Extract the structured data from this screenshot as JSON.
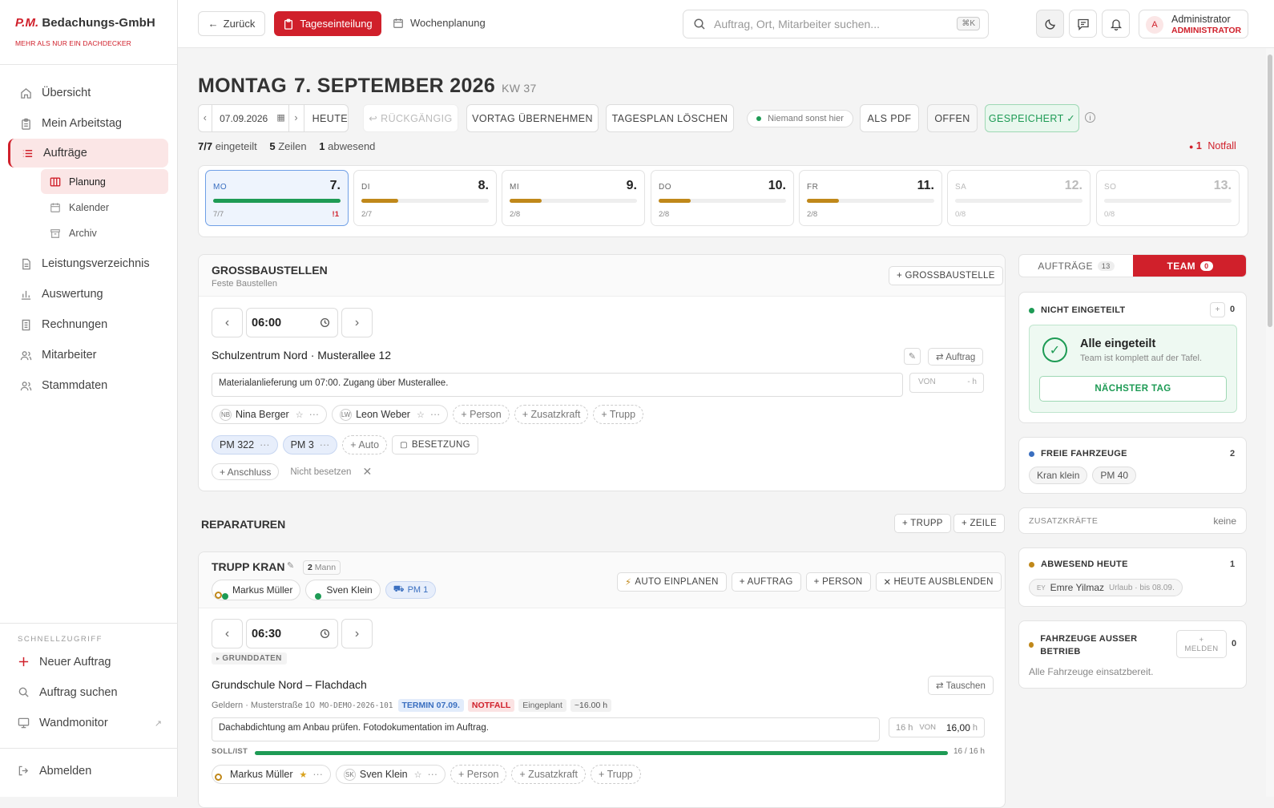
{
  "brand": {
    "pm": "P.M.",
    "name": "Bedachungs-GmbH",
    "tagline": "MEHR ALS NUR EIN DACHDECKER"
  },
  "nav": {
    "uebersicht": "Übersicht",
    "arbeitstag": "Mein Arbeitstag",
    "auftraege": "Aufträge",
    "planung": "Planung",
    "kalender": "Kalender",
    "archiv": "Archiv",
    "leistung": "Leistungsverzeichnis",
    "auswertung": "Auswertung",
    "rechnungen": "Rechnungen",
    "mitarbeiter": "Mitarbeiter",
    "stammdaten": "Stammdaten"
  },
  "quick": {
    "title": "SCHNELLZUGRIFF",
    "neu": "Neuer Auftrag",
    "suchen": "Auftrag suchen",
    "wand": "Wandmonitor",
    "abmelden": "Abmelden"
  },
  "topbar": {
    "back": "Zurück",
    "tages": "Tageseinteilung",
    "wochen": "Wochenplanung",
    "search_ph": "Auftrag, Ort, Mitarbeiter suchen...",
    "kbd": "⌘K",
    "user_name": "Administrator",
    "user_role": "ADMINISTRATOR",
    "avatar": "A"
  },
  "header": {
    "weekday": "MONTAG",
    "date": "7. SEPTEMBER 2026",
    "kw": "KW 37"
  },
  "toolbar": {
    "date": "07.09.2026",
    "heute": "HEUTE",
    "undo": "↩ RÜCKGÄNGIG",
    "vortag": "VORTAG ÜBERNEHMEN",
    "loeschen": "TAGESPLAN LÖSCHEN",
    "niemand": "Niemand sonst hier",
    "pdf": "ALS PDF",
    "offen": "OFFEN",
    "gespeichert": "GESPEICHERT ✓"
  },
  "stats": {
    "eingeteilt": "7/7",
    "eingeteilt_l": "eingeteilt",
    "zeilen": "5",
    "zeilen_l": "Zeilen",
    "abwesend": "1",
    "abwesend_l": "abwesend",
    "notfall_n": "1",
    "notfall_l": "Notfall"
  },
  "days": [
    {
      "name": "MO",
      "num": "7.",
      "count": "7/7",
      "progress": 1.0,
      "alert": "!1"
    },
    {
      "name": "DI",
      "num": "8.",
      "count": "2/7",
      "progress": 0.29,
      "alert": ""
    },
    {
      "name": "MI",
      "num": "9.",
      "count": "2/8",
      "progress": 0.25,
      "alert": ""
    },
    {
      "name": "DO",
      "num": "10.",
      "count": "2/8",
      "progress": 0.25,
      "alert": ""
    },
    {
      "name": "FR",
      "num": "11.",
      "count": "2/8",
      "progress": 0.25,
      "alert": ""
    },
    {
      "name": "SA",
      "num": "12.",
      "count": "0/8",
      "progress": 0,
      "alert": ""
    },
    {
      "name": "SO",
      "num": "13.",
      "count": "0/8",
      "progress": 0,
      "alert": ""
    }
  ],
  "gross": {
    "title": "GROSSBAUSTELLEN",
    "sub": "Feste Baustellen",
    "add": "+ GROSSBAUSTELLE",
    "time": "06:00",
    "site": "Schulzentrum Nord · Musterallee 12",
    "auftrag": "⇄ Auftrag",
    "note": "Materialanlieferung um 07:00. Zugang über Musterallee.",
    "von": "VON",
    "h": "- h",
    "people": [
      {
        "ini": "NB",
        "name": "Nina Berger"
      },
      {
        "ini": "LW",
        "name": "Leon Weber"
      }
    ],
    "add_person": "+ Person",
    "add_zusatz": "+ Zusatzkraft",
    "add_trupp": "+ Trupp",
    "vehicles": [
      "PM 322",
      "PM 3"
    ],
    "add_auto": "+ Auto",
    "besetzung": "BESETZUNG",
    "anschluss": "+ Anschluss",
    "nicht_besetzen": "Nicht besetzen"
  },
  "rep": {
    "title": "REPARATUREN",
    "trupp": "+ TRUPP",
    "zeile": "+ ZEILE",
    "trupp_name": "TRUPP KRAN",
    "mann": "2",
    "mann_l": "Mann",
    "members": [
      {
        "ini": "MM",
        "name": "Markus Müller"
      },
      {
        "ini": "SK",
        "name": "Sven Klein"
      }
    ],
    "vehicle": "PM 1",
    "auto": "AUTO EINPLANEN",
    "add_auftrag": "+ AUFTRAG",
    "add_person": "+ PERSON",
    "ausblenden": "HEUTE AUSBLENDEN",
    "time": "06:30",
    "grunddaten": "GRUNDDATEN",
    "job": "Grundschule Nord – Flachdach",
    "tauschen": "⇄ Tauschen",
    "addr": "Geldern · Musterstraße 10",
    "id": "MO-DEMO-2026-101",
    "termin": "TERMIN 07.09.",
    "notfall": "NOTFALL",
    "eingeplant": "Eingeplant",
    "hours": "~16.00 h",
    "note": "Dachabdichtung am Anbau prüfen. Fotodokumentation im Auftrag.",
    "h16": "16 h",
    "von": "VON",
    "von_val": "16,00",
    "h": "h",
    "sollist": "SOLL/IST",
    "soll_val": "16 / 16 h",
    "soll_progress": 1.0,
    "people": [
      {
        "ini": "MM",
        "name": "Markus Müller"
      },
      {
        "ini": "SK",
        "name": "Sven Klein"
      }
    ],
    "add_person2": "+ Person",
    "add_zusatz": "+ Zusatzkraft",
    "add_trupp": "+ Trupp"
  },
  "right": {
    "tab_auftraege": "AUFTRÄGE",
    "tab_auftraege_n": "13",
    "tab_team": "TEAM",
    "tab_team_n": "0",
    "nicht": "NICHT EINGETEILT",
    "nicht_n": "0",
    "alle": "Alle eingeteilt",
    "alle_sub": "Team ist komplett auf der Tafel.",
    "naechster": "NÄCHSTER TAG",
    "frei": "FREIE FAHRZEUGE",
    "frei_n": "2",
    "frei_list": [
      "Kran klein",
      "PM 40"
    ],
    "zusatz": "ZUSATZKRÄFTE",
    "zusatz_v": "keine",
    "abw": "ABWESEND HEUTE",
    "abw_n": "1",
    "abw_ini": "EY",
    "abw_name": "Emre Yilmaz",
    "abw_info": "Urlaub · bis 08.09.",
    "ausser": "FAHRZEUGE AUSSER BETRIEB",
    "ausser_n": "0",
    "melden": "+ MELDEN",
    "ausser_info": "Alle Fahrzeuge einsatzbereit."
  },
  "colors": {
    "accent": "#d0202b",
    "green": "#1e9b55",
    "amber": "#c0881a",
    "blue": "#3a6fc0"
  }
}
